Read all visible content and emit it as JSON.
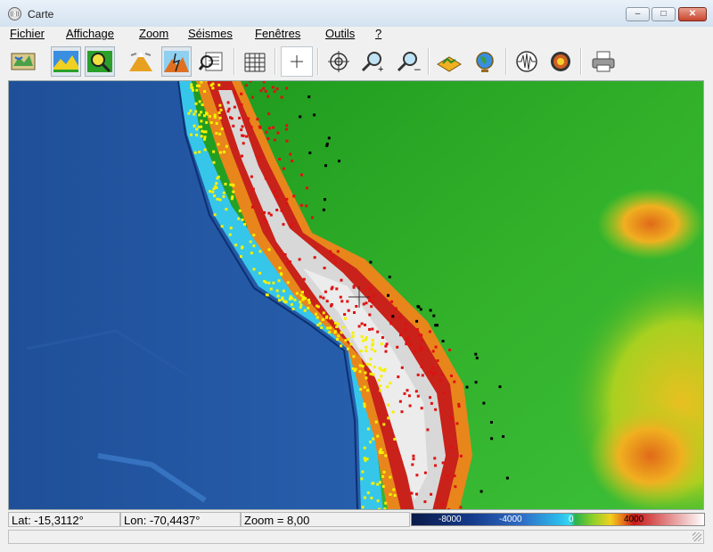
{
  "window": {
    "title": "Carte",
    "controls": {
      "minimize": "–",
      "maximize": "□",
      "close": "✕"
    }
  },
  "menu": [
    "Fichier",
    "Affichage",
    "Zoom",
    "Séismes",
    "Fenêtres",
    "Outils",
    "?"
  ],
  "toolbar": {
    "buttons": [
      {
        "name": "map-view-button",
        "icon": "map-icon",
        "active": false
      },
      {
        "name": "relief-view-button",
        "icon": "landscape-icon",
        "active": true
      },
      {
        "name": "magnifier-view-button",
        "icon": "magnifier-icon",
        "active": true
      },
      {
        "name": "volcano-button",
        "icon": "volcano-icon",
        "active": false
      },
      {
        "name": "fault-button",
        "icon": "fault-icon",
        "active": true
      },
      {
        "name": "search-document-button",
        "icon": "document-search-icon",
        "active": false
      },
      {
        "name": "grid-button",
        "icon": "grid-icon",
        "active": false
      },
      {
        "name": "crosshair-button",
        "icon": "crosshair-icon",
        "active": false
      },
      {
        "name": "target-button",
        "icon": "target-icon",
        "active": false
      },
      {
        "name": "zoom-in-button",
        "icon": "zoom-in-icon",
        "active": false
      },
      {
        "name": "zoom-out-button",
        "icon": "zoom-out-icon",
        "active": false
      },
      {
        "name": "3d-terrain-button",
        "icon": "3d-terrain-icon",
        "active": false
      },
      {
        "name": "globe-button",
        "icon": "globe-icon",
        "active": false
      },
      {
        "name": "seismogram-button",
        "icon": "seismogram-icon",
        "active": false
      },
      {
        "name": "earth-core-button",
        "icon": "earth-core-icon",
        "active": false
      },
      {
        "name": "print-button",
        "icon": "printer-icon",
        "active": false
      }
    ]
  },
  "status": {
    "lat": "Lat: -15,3112°",
    "lon": "Lon: -70,4437°",
    "zoom": "Zoom = 8,00",
    "legend": {
      "labels": [
        "-8000",
        "-4000",
        "0",
        "4000"
      ]
    }
  },
  "colors": {
    "ocean_deep": "#1e4f9c",
    "ocean_shelf": "#38c8ec",
    "lowland": "#1fa51f",
    "highland": "#e0701a",
    "summit": "#d8d8d8",
    "quake_shallow": "#f5f000",
    "quake_intermediate": "#e01010",
    "quake_deep": "#000000"
  }
}
